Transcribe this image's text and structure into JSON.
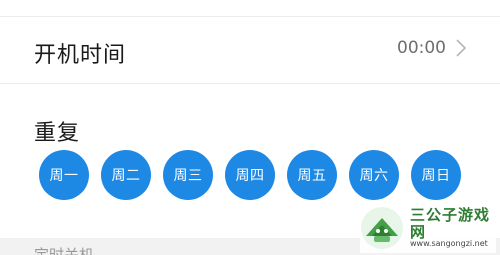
{
  "power_on": {
    "label": "开机时间",
    "value": "00:00"
  },
  "repeat": {
    "label": "重复",
    "days": [
      "周一",
      "周二",
      "周三",
      "周四",
      "周五",
      "周六",
      "周日"
    ]
  },
  "next_section": {
    "label": "定时关机"
  },
  "watermark": {
    "title": "三公子游戏网",
    "url": "www.sangongzi.net"
  },
  "colors": {
    "day_selected": "#1e88e5",
    "watermark_green": "#2e7d32"
  }
}
